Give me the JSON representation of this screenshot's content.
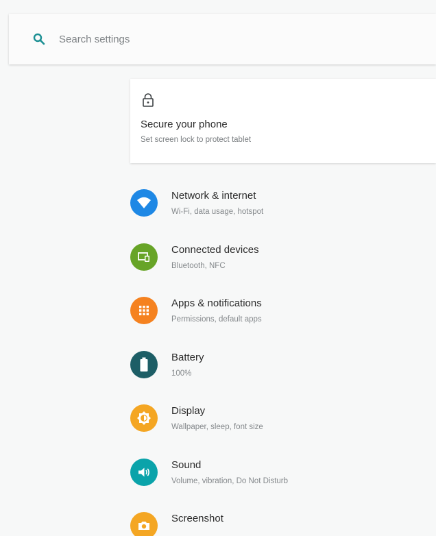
{
  "search": {
    "placeholder": "Search settings",
    "icon": "search-icon"
  },
  "suggestion_card": {
    "icon": "lock-icon",
    "title": "Secure your phone",
    "subtitle": "Set screen lock to protect tablet"
  },
  "settings": [
    {
      "title": "Network & internet",
      "subtitle": "Wi-Fi, data usage, hotspot",
      "icon": "wifi-icon",
      "color": "#1e88e5"
    },
    {
      "title": "Connected devices",
      "subtitle": "Bluetooth, NFC",
      "icon": "devices-icon",
      "color": "#67a427"
    },
    {
      "title": "Apps & notifications",
      "subtitle": "Permissions, default apps",
      "icon": "apps-grid-icon",
      "color": "#f58220"
    },
    {
      "title": "Battery",
      "subtitle": "100%",
      "icon": "battery-icon",
      "color": "#1d5e66"
    },
    {
      "title": "Display",
      "subtitle": "Wallpaper, sleep, font size",
      "icon": "brightness-icon",
      "color": "#f4a623"
    },
    {
      "title": "Sound",
      "subtitle": "Volume, vibration, Do Not Disturb",
      "icon": "volume-icon",
      "color": "#0aa3aa"
    },
    {
      "title": "Screenshot",
      "subtitle": "",
      "icon": "camera-icon",
      "color": "#f4a623"
    }
  ]
}
